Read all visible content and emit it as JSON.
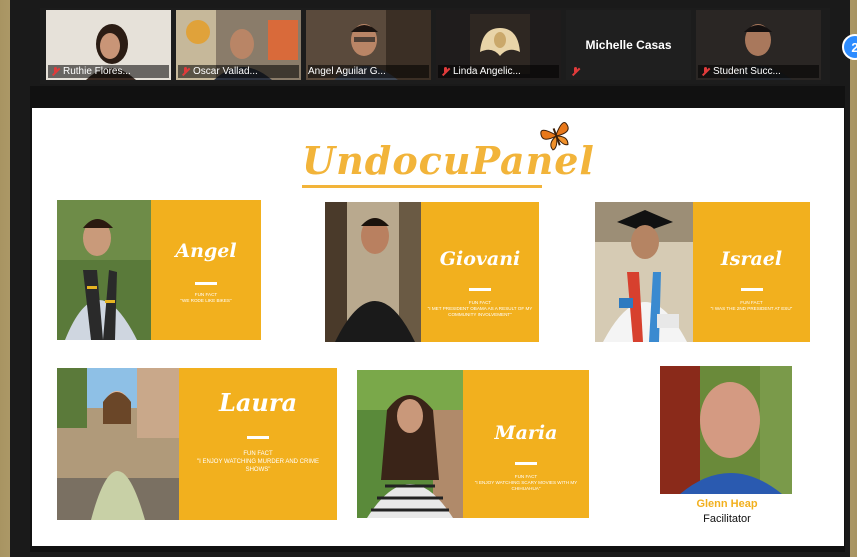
{
  "participants": [
    {
      "name": "Ruthie Flores...",
      "muted": true
    },
    {
      "name": "Oscar Vallad...",
      "muted": true
    },
    {
      "name": "Angel Aguilar G...",
      "muted": false,
      "active": true
    },
    {
      "name": "Linda Angelic...",
      "muted": true
    },
    {
      "name": "Michelle Casas",
      "muted": true,
      "video_off": true
    },
    {
      "name": "Student Succ...",
      "muted": true
    }
  ],
  "more_button": {
    "label": "2"
  },
  "slide": {
    "title": "UndocuPanel",
    "panelists": [
      {
        "name": "Angel",
        "fun_fact_label": "Fun fact",
        "fun_fact": "\"We rode like Bikes\""
      },
      {
        "name": "Giovani",
        "fun_fact_label": "Fun fact",
        "fun_fact": "\"I met president Obama as a result of my community involvement\""
      },
      {
        "name": "Israel",
        "fun_fact_label": "Fun fact",
        "fun_fact": "\"I was the 2nd president at ESU\""
      },
      {
        "name": "Laura",
        "fun_fact_label": "Fun fact",
        "fun_fact": "\"I enjoy watching murder and crime shows\""
      },
      {
        "name": "Maria",
        "fun_fact_label": "Fun fact",
        "fun_fact": "\"I enjoy watching scary movies with my chihuahua\""
      }
    ],
    "facilitator": {
      "name": "Glenn Heap",
      "role": "Facilitator"
    }
  },
  "colors": {
    "accent": "#f2b01e",
    "title": "#f2b43a",
    "active_speaker": "#8fbf3a",
    "zoom_blue": "#2d8cff",
    "mute_red": "#e03b3b"
  },
  "icons": [
    "mic-muted-icon",
    "butterfly-icon",
    "more-participants-icon"
  ]
}
